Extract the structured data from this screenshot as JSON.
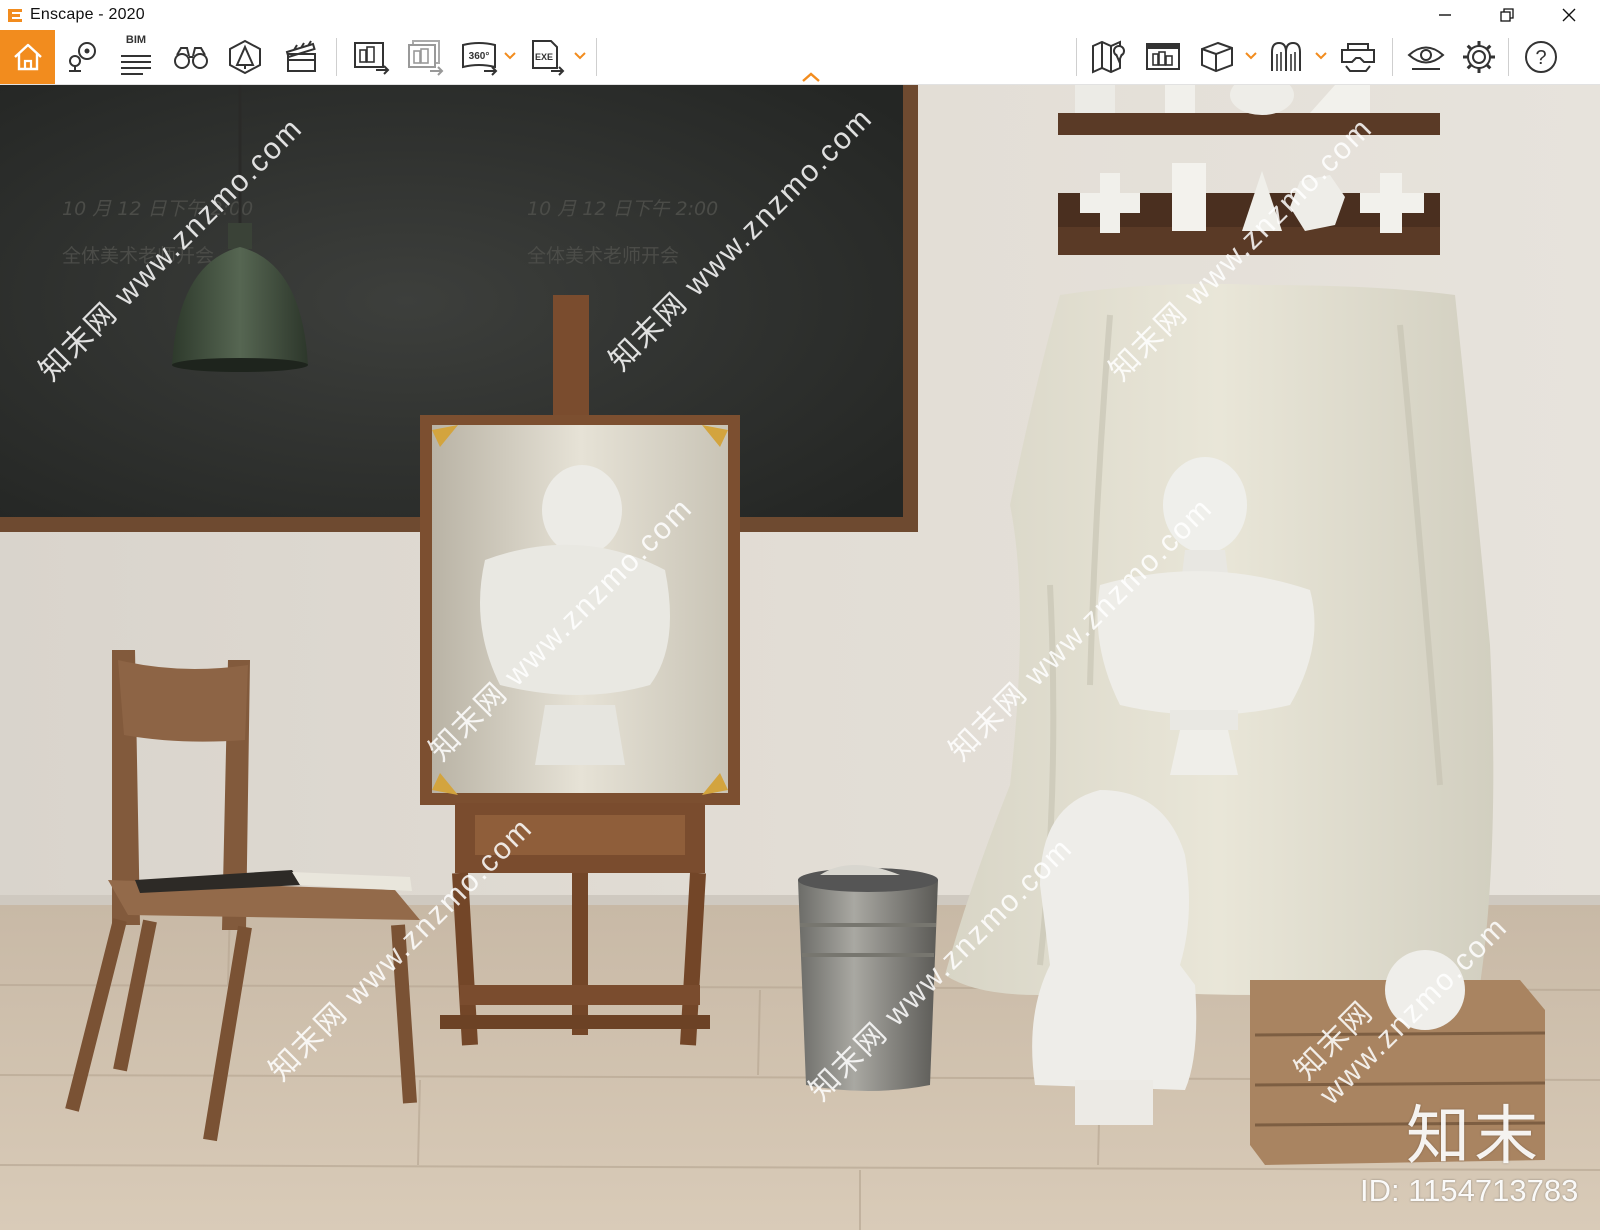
{
  "window": {
    "title": "Enscape - 2020",
    "controls": [
      "minimize-icon",
      "restore-icon",
      "close-icon"
    ]
  },
  "toolbar": {
    "accent_color": "#f28c1e",
    "left_buttons": [
      {
        "name": "home-button",
        "icon": "home-icon"
      },
      {
        "name": "views-button",
        "icon": "map-pin-icon"
      },
      {
        "name": "bim-button",
        "icon": "bim-list-icon",
        "label": "BIM"
      },
      {
        "name": "binoculars-button",
        "icon": "binoculars-icon"
      },
      {
        "name": "asset-library-button",
        "icon": "asset-library-icon"
      },
      {
        "name": "video-editor-button",
        "icon": "clapperboard-icon"
      },
      {
        "name": "screenshot-button",
        "icon": "screenshot-icon"
      },
      {
        "name": "batch-render-button",
        "icon": "batch-render-icon"
      },
      {
        "name": "panorama-button",
        "icon": "panorama-360-icon",
        "label": "360°"
      },
      {
        "name": "export-exe-button",
        "icon": "export-exe-icon",
        "label": "EXE"
      }
    ],
    "right_buttons": [
      {
        "name": "map-button",
        "icon": "map-icon"
      },
      {
        "name": "collaborative-annotation-button",
        "icon": "annotation-icon"
      },
      {
        "name": "cube-view-button",
        "icon": "cube-icon"
      },
      {
        "name": "material-editor-button",
        "icon": "material-icon"
      },
      {
        "name": "vr-headset-button",
        "icon": "vr-headset-icon"
      },
      {
        "name": "visual-settings-button",
        "icon": "eye-icon"
      },
      {
        "name": "settings-button",
        "icon": "gear-icon"
      },
      {
        "name": "help-button",
        "icon": "help-icon",
        "label": "?"
      }
    ]
  },
  "viewport": {
    "scene": "rendered art studio interior",
    "chalkboard_text": [
      "10 月 12 日下午 2:00",
      "全体美术老师开会"
    ],
    "watermark_text": "知末网 www.znzmo.com",
    "watermark_logo": "知末",
    "watermark_id": "ID: 1154713783"
  }
}
